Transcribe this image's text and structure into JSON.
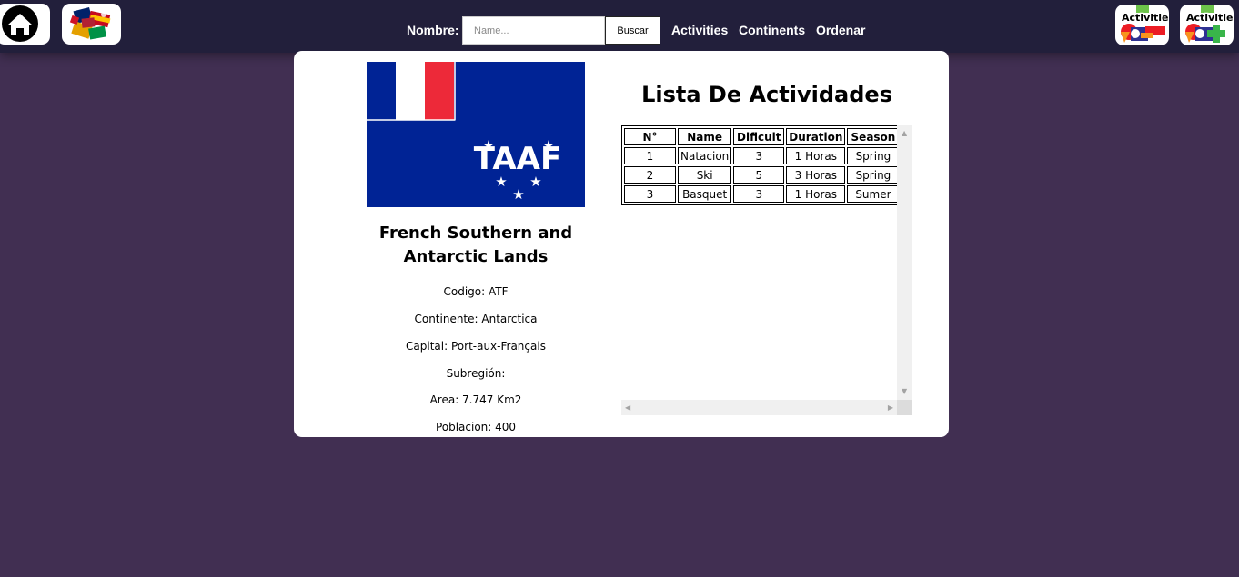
{
  "navbar": {
    "search_label": "Nombre:",
    "search_placeholder": "Name...",
    "search_button": "Buscar",
    "links": [
      "Activities",
      "Continents",
      "Ordenar"
    ],
    "tile_text_1": "Activitie",
    "tile_text_2": "Activitie"
  },
  "country": {
    "name": "French Southern and Antarctic Lands",
    "flag_letters": "TAAF",
    "codigo": "Codigo: ATF",
    "continente": "Continente: Antarctica",
    "capital": "Capital: Port-aux-Français",
    "subregion": "Subregión:",
    "area": "Area: 7.747 Km2",
    "poblacion": "Poblacion: 400"
  },
  "activities": {
    "title": "Lista De Actividades",
    "columns": [
      "N°",
      "Name",
      "Dificult",
      "Duration",
      "Season"
    ],
    "rows": [
      [
        "1",
        "Natacion",
        "3",
        "1 Horas",
        "Spring"
      ],
      [
        "2",
        "Ski",
        "5",
        "3 Horas",
        "Spring"
      ],
      [
        "3",
        "Basquet",
        "3",
        "1 Horas",
        "Sumer"
      ]
    ]
  },
  "colors": {
    "background": "#412f52",
    "navbar": "#221f3b",
    "flag_blue": "#002395",
    "flag_red": "#ed2939"
  }
}
